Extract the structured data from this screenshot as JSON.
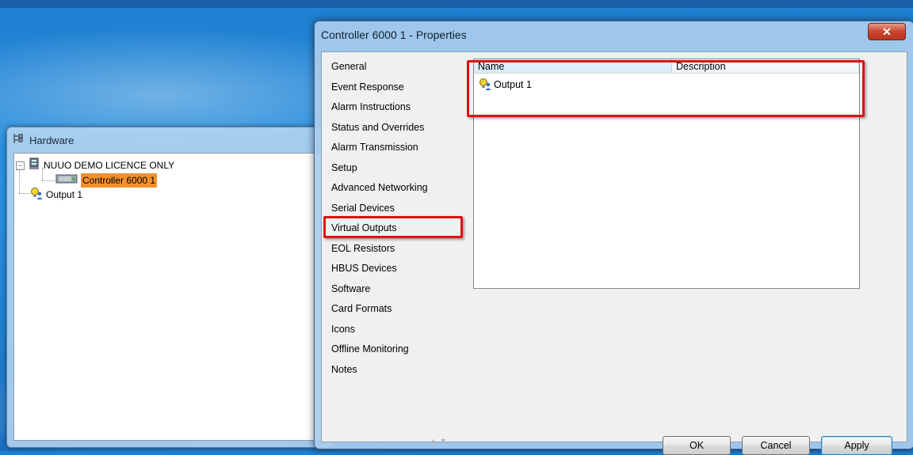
{
  "hardware": {
    "title": "Hardware",
    "tree": {
      "root_label": "NUUO DEMO LICENCE ONLY",
      "controller_label": "Controller 6000 1",
      "output_label": "Output 1"
    }
  },
  "dialog": {
    "title": "Controller 6000 1 - Properties",
    "close_glyph": "✕",
    "nav_items": [
      "General",
      "Event Response",
      "Alarm Instructions",
      "Status and Overrides",
      "Alarm Transmission",
      "Setup",
      "Advanced Networking",
      "Serial Devices",
      "Virtual Outputs",
      "EOL Resistors",
      "HBUS Devices",
      "Software",
      "Card Formats",
      "Icons",
      "Offline Monitoring",
      "Notes"
    ],
    "selected_nav": "Virtual Outputs",
    "list": {
      "columns": [
        "Name",
        "Description"
      ],
      "rows": [
        {
          "name": "Output 1",
          "description": ""
        }
      ]
    },
    "buttons": {
      "ok": "OK",
      "cancel": "Cancel",
      "apply": "Apply"
    }
  },
  "colors": {
    "highlight_orange": "#f4902a",
    "annotation_red": "#dd1111",
    "close_red": "#c8452e"
  },
  "icons": {
    "hardware_window": "hardware-tree-icon",
    "root_node": "server-icon",
    "controller_node": "controller-icon",
    "output_node": "lightbulb-user-icon"
  }
}
